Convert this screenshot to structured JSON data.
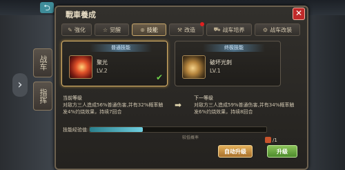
{
  "game": {
    "back_icon": "back-arrow-icon",
    "side_tabs": [
      "战车",
      "指挥"
    ],
    "side_arrow": "›"
  },
  "panel": {
    "title": "戰車養成",
    "close_label": "✕"
  },
  "tabs": [
    {
      "label": "強化",
      "icon": "✎",
      "active": false
    },
    {
      "label": "觉醒",
      "icon": "☆",
      "active": false
    },
    {
      "label": "技能",
      "icon": "⊕",
      "active": true
    },
    {
      "label": "改造",
      "icon": "⚒",
      "active": false,
      "alert": true
    },
    {
      "label": "战车培养",
      "icon": "⛟",
      "active": false
    },
    {
      "label": "战车改装",
      "icon": "⚙",
      "active": false
    }
  ],
  "skills": [
    {
      "header": "普通技能",
      "name": "聚光",
      "level": "LV.2",
      "selected": true
    },
    {
      "header": "终极技能",
      "name": "破坏光刺",
      "level": "LV.1",
      "selected": false
    }
  ],
  "current_level": {
    "heading": "当前等级",
    "description": "对敌方三人造成56%普通伤害,并有32%概率触发4%灼烧效果，持续7回合"
  },
  "next_level": {
    "heading": "下一等级",
    "description": "对敌方三人造成59%普通伤害,并有34%概率触发6%灼烧效果，持续8回合"
  },
  "exp": {
    "label": "技能经验值:",
    "progress": 0.3,
    "note": "较低概率"
  },
  "upgrade_item": {
    "count": "/1"
  },
  "buttons": {
    "auto_upgrade": "自动升级",
    "upgrade": "升级"
  },
  "colors": {
    "accent": "#d8b26a",
    "exp_bar": "#6fcfe0",
    "upgrade_button": "#8cc45a",
    "auto_button": "#e3b05a",
    "close_button": "#c02a2a"
  }
}
